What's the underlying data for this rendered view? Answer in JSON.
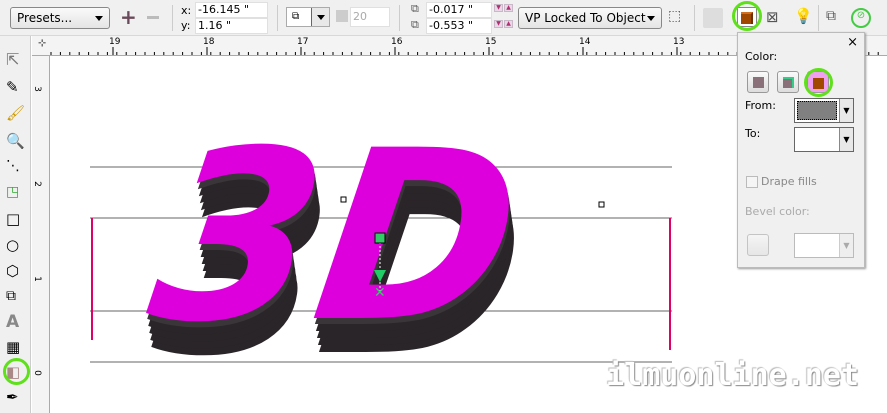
{
  "toolbar": {
    "presets": "Presets...",
    "x_label": "x:",
    "x_value": "-16.145 \"",
    "y_label": "y:",
    "y_value": "1.16 \"",
    "depth_value": "20",
    "vp_x_value": "-0.017 \"",
    "vp_y_value": "-0.553 \"",
    "vp_mode": "VP Locked To Object",
    "active_color": "#5ee01a"
  },
  "ruler": {
    "h_ticks": [
      "19",
      "18",
      "17",
      "16",
      "15",
      "14",
      "13"
    ],
    "v_ticks": [
      "3",
      "2",
      "1",
      "0"
    ]
  },
  "panel": {
    "color_label": "Color:",
    "from_label": "From:",
    "from_color": "#808080",
    "to_label": "To:",
    "to_color": "#ffffff",
    "drape_label": "Drape fills",
    "bevel_label": "Bevel color:",
    "close": "×"
  },
  "canvas": {
    "text": "3D",
    "face_color": "#dd00dd",
    "extrude_color": "#2a2528"
  },
  "watermark": "ilmuonline.net"
}
